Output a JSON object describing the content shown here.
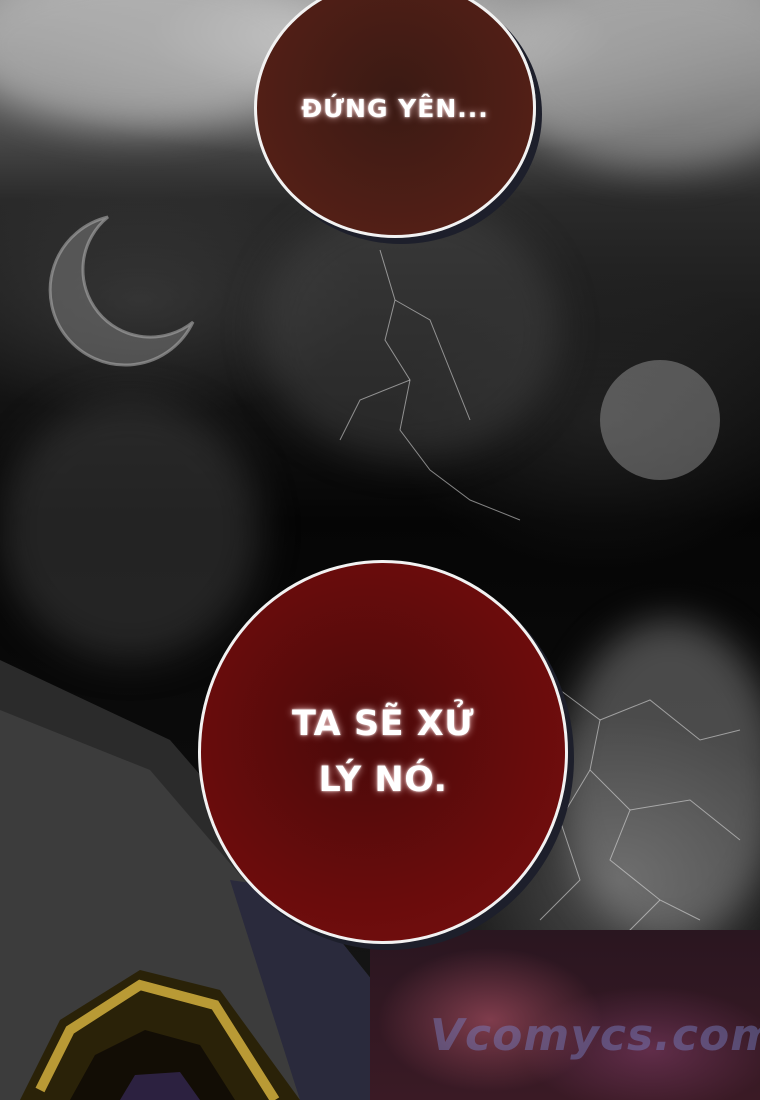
{
  "bubbles": [
    {
      "text": "ĐỨNG YÊN..."
    },
    {
      "text": "TA SẼ XỬ\nLÝ NÓ."
    }
  ],
  "watermark": {
    "text": "Vcomycs.com"
  },
  "colors": {
    "bubble_top_fill": "#521f16",
    "bubble_bottom_fill": "#6a0c0c",
    "bubble_border": "#f2f2f2",
    "background": "#050505"
  }
}
